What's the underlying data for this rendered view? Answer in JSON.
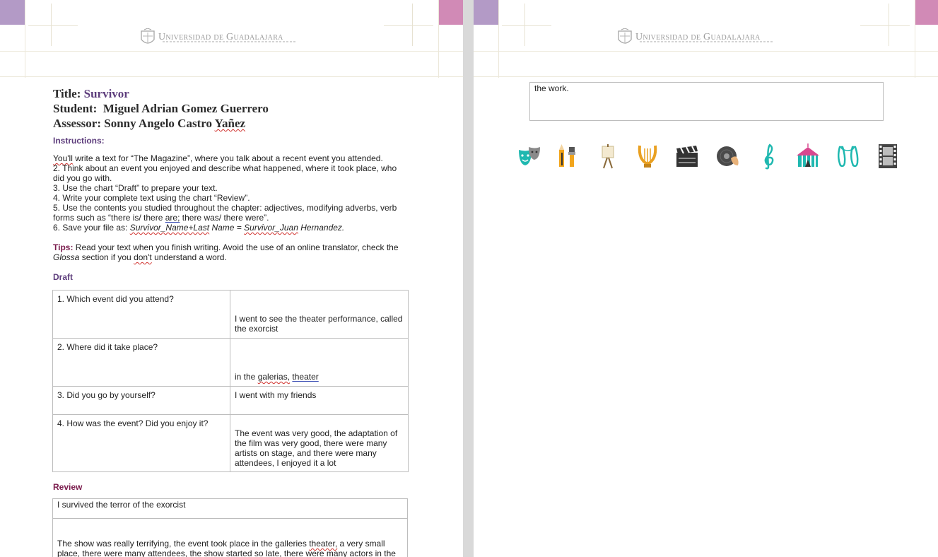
{
  "logo": {
    "name": "Universidad de Guadalajara"
  },
  "left": {
    "title_label": "Title",
    "title_value": "Survivor",
    "student_label": "Student:",
    "student_value": "Miguel Adrian Gomez Guerrero",
    "assessor_label": "Assessor:",
    "assessor_value": "Sonny Angelo Castro Yañez",
    "instructions_heading": "Instructions:",
    "instructions": [
      "1. You'll write a text for “The Magazine”, where you talk about a recent event you attended.",
      "2. Think about an event you enjoyed and describe what happened, where it took place, who did you go with.",
      "3. Use the chart “Draft” to prepare your text.",
      "4. Write your complete text using the chart “Review”.",
      "5. Use the contents you studied throughout the chapter: adjectives, modifying adverbs, verb forms such as “there is/ there are; there was/ there were”.",
      "6. Save your file as: Survivor_Name+Last Name = Survivor_Juan Hernandez."
    ],
    "tips_label": "Tips:",
    "tips_text": "Read your text when you finish writing. Avoid the use of an online translator, check the Glossa section if you don't understand a word.",
    "draft_heading": "Draft",
    "draft_rows": [
      {
        "q": "1. Which event did you attend?",
        "a": "I went to see the theater performance, called the exorcist"
      },
      {
        "q": "2. Where did it take place?",
        "a": "in the galerias, theater"
      },
      {
        "q": "3. Did you go by yourself?",
        "a": "I went with my friends"
      },
      {
        "q": "4. How was the event? Did you enjoy it?",
        "a": "The event was very good, the adaptation of the film was very good, there were many artists on stage, and there were many attendees, I enjoyed it a lot"
      }
    ],
    "review_heading": "Review",
    "review_title": "I survived the terror of the exorcist",
    "review_body": "The show was really terrifying, the event took place in the galleries theater, a very small place, there were many attendees, the show started so late, there were many actors in the"
  },
  "right": {
    "continued_text": "the work."
  },
  "icons": [
    "theater-masks-icon",
    "pencil-brush-icon",
    "easel-icon",
    "lyre-icon",
    "clapperboard-icon",
    "vinyl-record-icon",
    "treble-clef-icon",
    "circus-tent-icon",
    "ballet-shoes-icon",
    "film-strip-icon"
  ],
  "colors": {
    "accent_purple": "#5d3d7c",
    "accent_maroon": "#7a1b4c",
    "corner_lilac": "#b39ac6",
    "corner_pink": "#d18ab6"
  }
}
